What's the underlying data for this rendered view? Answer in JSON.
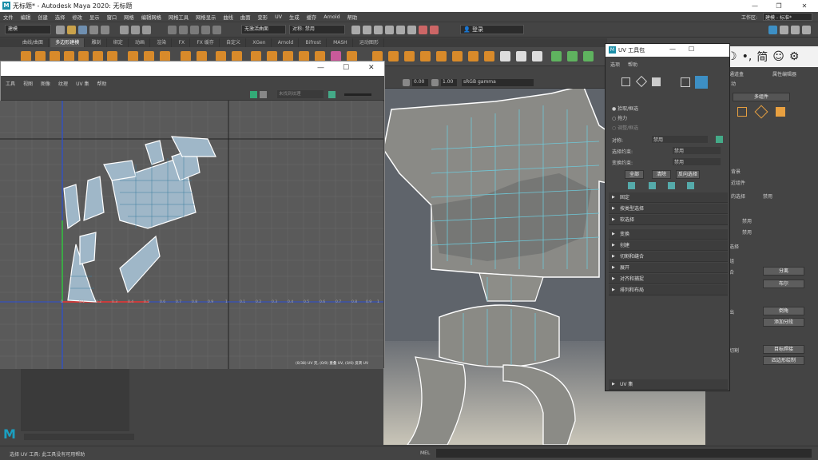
{
  "app": {
    "title": "无标题* - Autodesk Maya 2020: 无标题",
    "workspace_label": "工作区:",
    "workspace_value": "建模 - 标准*",
    "menus": [
      "文件",
      "编辑",
      "创建",
      "选择",
      "修改",
      "显示",
      "窗口",
      "网格",
      "编辑网格",
      "网格工具",
      "网格显示",
      "曲线",
      "曲面",
      "变形",
      "UV",
      "生成",
      "缓存",
      "Arnold",
      "帮助"
    ],
    "mode_dropdown": "建模",
    "live_surface": "无激活曲面",
    "symmetry": "对称: 禁用",
    "login": "登录"
  },
  "shelf": {
    "tabs": [
      "曲线/曲面",
      "多边形建模",
      "雕刻",
      "绑定",
      "动画",
      "渲染",
      "FX",
      "FX 缓存",
      "自定义",
      "XGen",
      "Arnold",
      "Bifrost",
      "MASH",
      "运动图形"
    ],
    "active_tab": "多边形建模"
  },
  "uv_editor": {
    "menus": [
      "工具",
      "视图",
      "图像",
      "纹理",
      "UV 集",
      "帮助"
    ],
    "texture_field_placeholder": "未找到纹理",
    "status_text": "(0/38) UV 壳, (0/0) 重叠 UV, (0/0) 反转 UV",
    "axis_ticks_x": [
      "0",
      "0.1",
      "0.2",
      "0.3",
      "0.4",
      "0.5",
      "0.6",
      "0.7",
      "0.8",
      "0.9",
      "1",
      "0.1",
      "0.2",
      "0.3",
      "0.4",
      "0.5",
      "0.6",
      "0.7",
      "0.8",
      "0.9",
      "1"
    ]
  },
  "viewport_toolbar": {
    "value1": "0.00",
    "value2": "1.00",
    "color_space": "sRGB gamma"
  },
  "uv_toolkit": {
    "title": "UV 工具包",
    "menus": [
      "选项",
      "帮助"
    ],
    "radio_options": [
      "拾取/框选",
      "拖力",
      "调整/框选"
    ],
    "symmetry_label": "对称:",
    "symmetry_value": "禁用",
    "select_constraint_label": "选择约束:",
    "select_constraint_value": "禁用",
    "transform_constraint_label": "变换约束:",
    "transform_constraint_value": "禁用",
    "buttons": [
      "全部",
      "清除",
      "反向选择"
    ],
    "sections_a": [
      "固定",
      "按类型选择",
      "软选择"
    ],
    "sections_b": [
      "变换",
      "创建",
      "切割和缝合",
      "展开",
      "对齐和捕捉",
      "排列和布局"
    ],
    "uv_sets": "UV 集"
  },
  "right_panel": {
    "tabs": [
      "通道盒",
      "属性编辑器"
    ],
    "multi_component": "多组件",
    "labels": [
      "动",
      "背景",
      "近组件",
      "的选择",
      "禁用",
      "禁用",
      "禁用",
      "选择",
      "组"
    ],
    "buttons": [
      "分离",
      "布尔",
      "倒角",
      "添加分段",
      "目标焊接",
      "四边形绘制"
    ],
    "left_cut_labels": [
      "合",
      "出",
      "切割"
    ],
    "sub_labels": [
      "选择",
      "合",
      "出",
      "切割"
    ]
  },
  "status_bar": {
    "help_text": "选择 UV 工具: 此工具没有可用帮助",
    "script_lang": "MEL"
  },
  "ime": {
    "chars": [
      "英",
      "☽",
      "•,",
      "简",
      "☺",
      "⚙"
    ]
  }
}
